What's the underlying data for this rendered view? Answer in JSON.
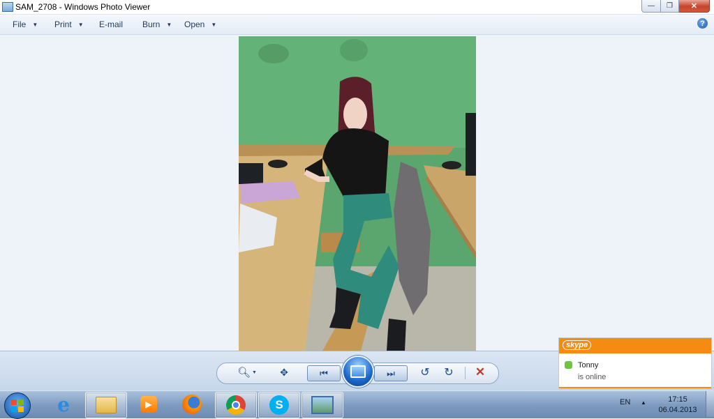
{
  "window": {
    "title": "SAM_2708 - Windows Photo Viewer"
  },
  "menu": {
    "file": "File",
    "print": "Print",
    "email": "E-mail",
    "burn": "Burn",
    "open": "Open"
  },
  "controls": {
    "zoom": "zoom-icon",
    "fit": "fit-to-window-icon",
    "previous": "previous-icon",
    "slideshow": "slideshow-icon",
    "next": "next-icon",
    "rotate_ccw": "rotate-counterclockwise-icon",
    "rotate_cw": "rotate-clockwise-icon",
    "delete": "delete-icon"
  },
  "skype": {
    "logo": "skype",
    "contact_name": "Tonny",
    "contact_status": "is online"
  },
  "tray": {
    "language": "EN",
    "time": "17:15",
    "date": "06.04.2013"
  },
  "colors": {
    "accent_orange": "#f68b11",
    "close_red": "#c7422b",
    "delete_red": "#c0392b",
    "wall_green": "#5aa66e",
    "trousers_teal": "#2f8c7c"
  }
}
